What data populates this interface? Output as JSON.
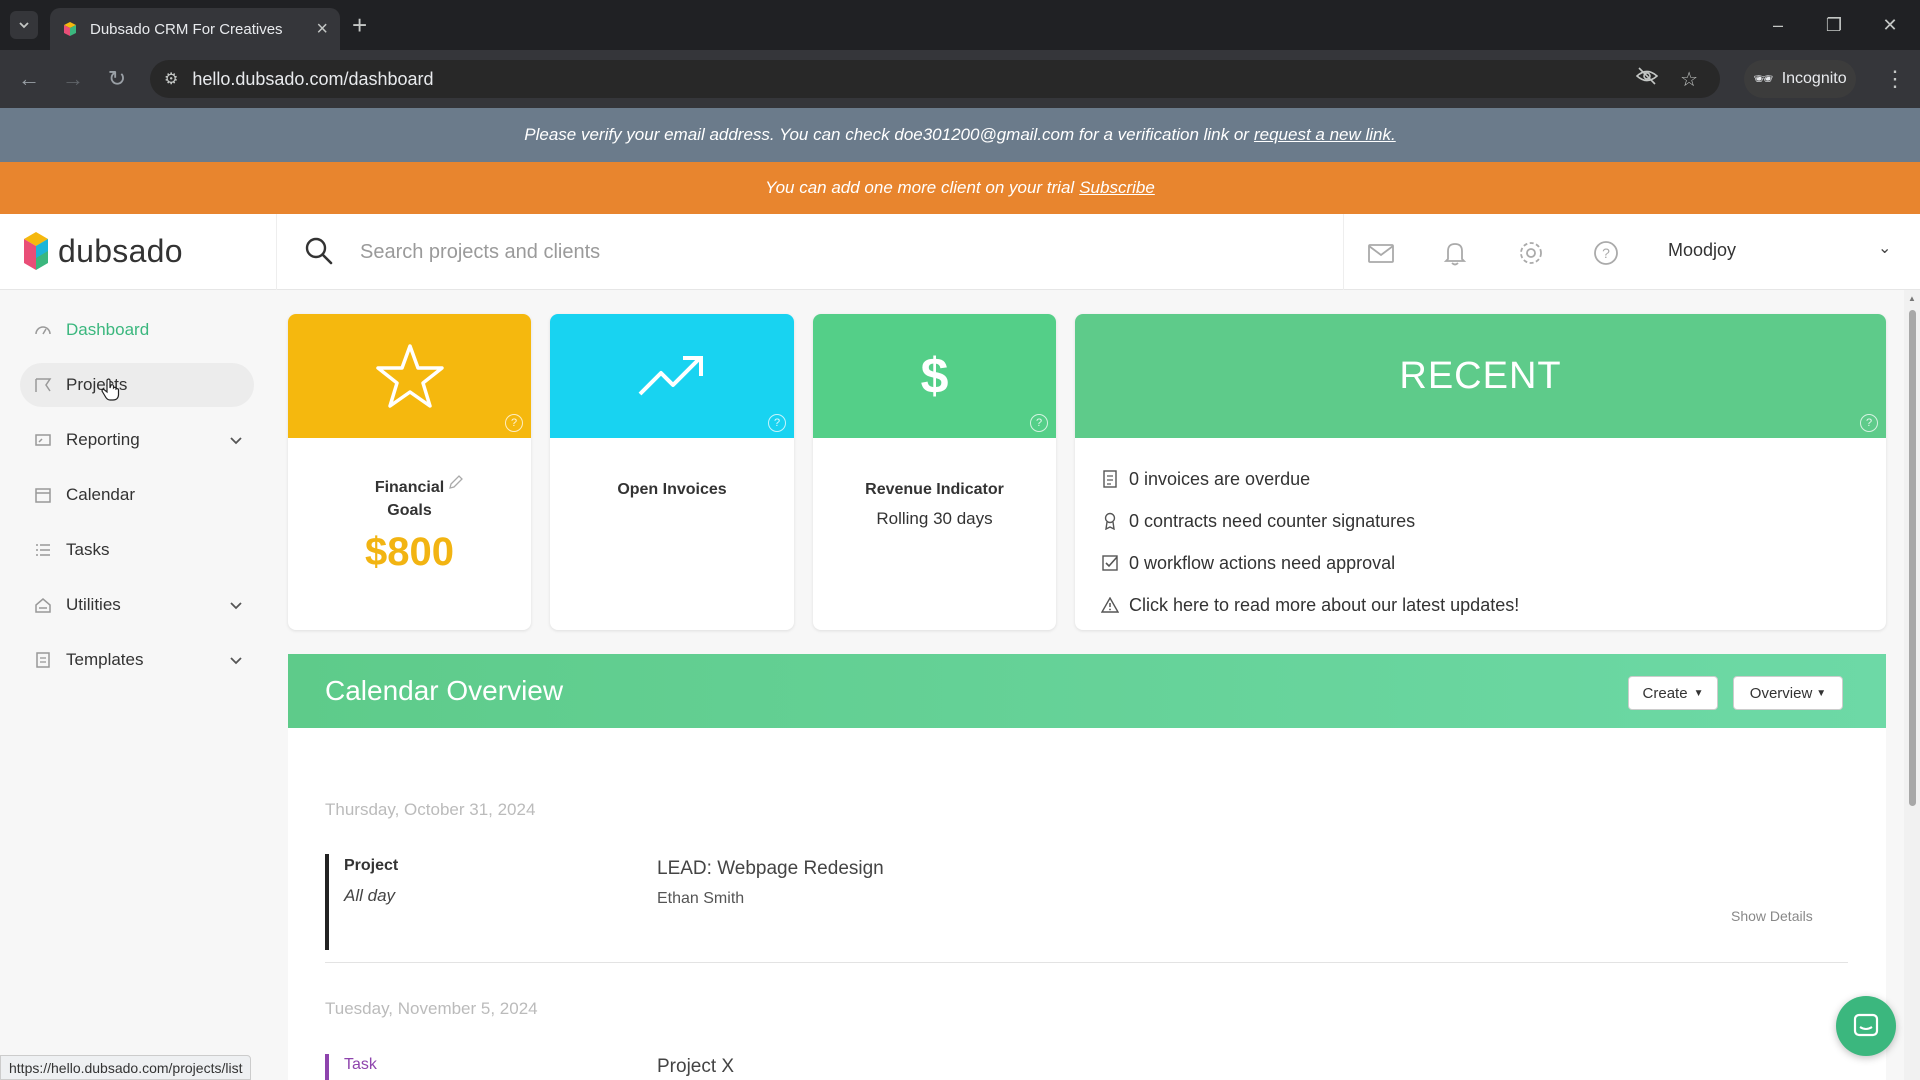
{
  "browser": {
    "tab_title": "Dubsado CRM For Creatives",
    "url": "hello.dubsado.com/dashboard",
    "incognito_label": "Incognito",
    "status_url": "https://hello.dubsado.com/projects/list"
  },
  "banners": {
    "verify_text": "Please verify your email address. You can check doe301200@gmail.com for a verification link or",
    "verify_link": "request a new link.",
    "trial_text": "You can add one more client on your trial",
    "trial_link": "Subscribe"
  },
  "header": {
    "logo_text": "dubsado",
    "search_placeholder": "Search projects and clients",
    "user_name": "Moodjoy",
    "icons": [
      "mail-icon",
      "bell-icon",
      "gear-icon",
      "help-icon"
    ]
  },
  "sidebar": {
    "items": [
      {
        "label": "Dashboard",
        "icon": "dashboard-icon",
        "active": true
      },
      {
        "label": "Projects",
        "icon": "projects-icon"
      },
      {
        "label": "Reporting",
        "icon": "reporting-icon",
        "expandable": true
      },
      {
        "label": "Calendar",
        "icon": "calendar-icon"
      },
      {
        "label": "Tasks",
        "icon": "tasks-icon"
      },
      {
        "label": "Utilities",
        "icon": "utilities-icon",
        "expandable": true
      },
      {
        "label": "Templates",
        "icon": "templates-icon",
        "expandable": true
      }
    ]
  },
  "cards": {
    "financial": {
      "title_line1": "Financial",
      "title_line2": "Goals",
      "amount": "$800",
      "color": "#f5b80e"
    },
    "invoices": {
      "title": "Open Invoices",
      "color": "#18d3f1"
    },
    "revenue": {
      "title": "Revenue Indicator",
      "subtitle": "Rolling 30 days",
      "color": "#54cf88"
    },
    "recent": {
      "title": "RECENT",
      "color": "#5ecb8a",
      "items": [
        {
          "text": "0 invoices are overdue",
          "icon": "invoice-icon"
        },
        {
          "text": "0 contracts need counter signatures",
          "icon": "award-icon"
        },
        {
          "text": "0 workflow actions need approval",
          "icon": "checkbox-icon"
        },
        {
          "text": "Click here to read more about our latest updates!",
          "icon": "warning-icon"
        }
      ]
    }
  },
  "calendar": {
    "title": "Calendar Overview",
    "create_label": "Create",
    "overview_label": "Overview",
    "days": [
      {
        "date": "Thursday, October 31, 2024",
        "events": [
          {
            "type": "Project",
            "time": "All day",
            "name": "LEAD: Webpage Redesign",
            "client": "Ethan Smith",
            "details_label": "Show Details"
          }
        ]
      },
      {
        "date": "Tuesday, November 5, 2024",
        "events": [
          {
            "type": "Task",
            "name": "Project X"
          }
        ]
      }
    ]
  }
}
